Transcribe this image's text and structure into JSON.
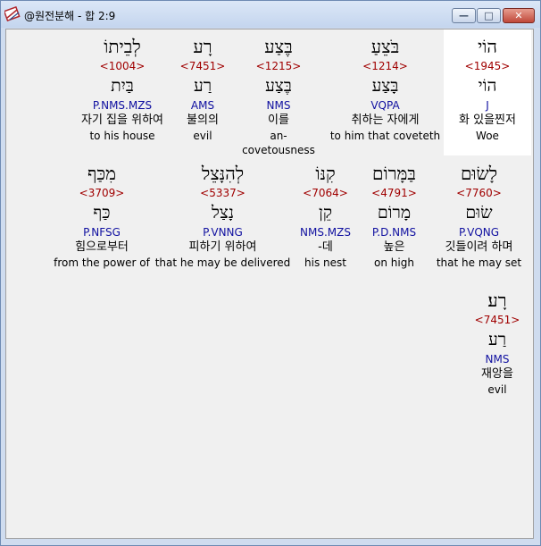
{
  "window": {
    "title": "@원전분해 - 합 2:9",
    "icon": "bible-app-icon"
  },
  "controls": {
    "minimize": "—",
    "maximize": "□",
    "close": "✕"
  },
  "rows": [
    [
      {
        "heb": "לְבֵיתוֹ",
        "strong": "<1004>",
        "lemma": "בַּיִת",
        "morph": "P.NMS.MZS",
        "kor": "자기 집을 위하여",
        "eng": "to his house"
      },
      {
        "heb": "רָע",
        "strong": "<7451>",
        "lemma": "רַע",
        "morph": "AMS",
        "kor": "불의의",
        "eng": "evil"
      },
      {
        "heb": "בֶּצַע",
        "strong": "<1215>",
        "lemma": "בֶּצַע",
        "morph": "NMS",
        "kor": "이를",
        "eng": "an-covetousness"
      },
      {
        "heb": "בֹּצֵעַ",
        "strong": "<1214>",
        "lemma": "בָּצַע",
        "morph": "VQPA",
        "kor": "취하는 자에게",
        "eng": "to him that coveteth"
      },
      {
        "heb": "הוֹי",
        "strong": "<1945>",
        "lemma": "הוֹי",
        "morph": "J",
        "kor": "화 있을찐저",
        "eng": "Woe"
      }
    ],
    [
      {
        "heb": "מִכַּף",
        "strong": "<3709>",
        "lemma": "כַּף",
        "morph": "P.NFSG",
        "kor": "힘으로부터",
        "eng": "from the power of"
      },
      {
        "heb": "לְהִנָּצֵל",
        "strong": "<5337>",
        "lemma": "נָצַל",
        "morph": "P.VNNG",
        "kor": "피하기 위하여",
        "eng": "that he may be delivered"
      },
      {
        "heb": "קִנּוֹ",
        "strong": "<7064>",
        "lemma": "קֵן",
        "morph": "NMS.MZS",
        "kor": "-데",
        "eng": "his nest"
      },
      {
        "heb": "בַּמָּרוֹם",
        "strong": "<4791>",
        "lemma": "מָרוֹם",
        "morph": "P.D.NMS",
        "kor": "높은",
        "eng": "on high"
      },
      {
        "heb": "לָשׂוּם",
        "strong": "<7760>",
        "lemma": "שׂוּם",
        "morph": "P.VQNG",
        "kor": "깃들이려 하며",
        "eng": "that he may set"
      }
    ],
    [
      {
        "heb": "רָע׃",
        "strong": "<7451>",
        "lemma": "רַע",
        "morph": "NMS",
        "kor": "재앙을",
        "eng": "evil"
      }
    ]
  ]
}
